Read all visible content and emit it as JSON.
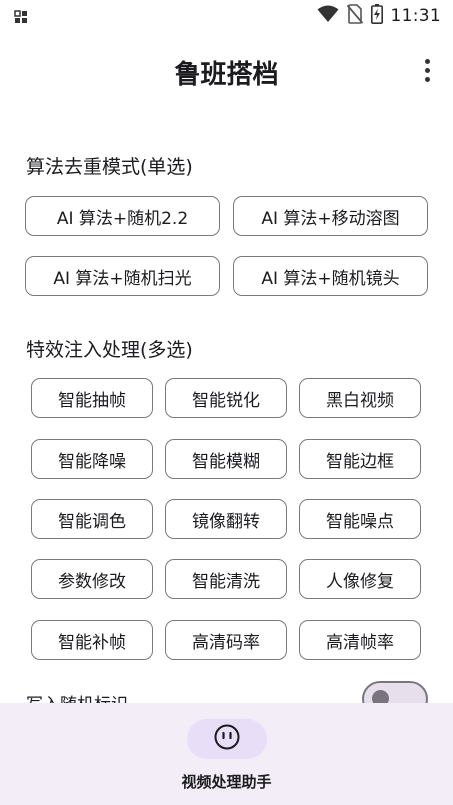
{
  "status_bar": {
    "time": "11:31",
    "icons": [
      "notification-grid-icon",
      "wifi-icon",
      "no-sim-icon",
      "battery-charging-icon"
    ]
  },
  "app_bar": {
    "title": "鲁班搭档",
    "menu_icon": "more-vert-icon"
  },
  "dedup_section": {
    "title": "算法去重模式(单选)",
    "options": [
      "AI 算法+随机2.2",
      "AI 算法+移动溶图",
      "AI 算法+随机扫光",
      "AI 算法+随机镜头"
    ]
  },
  "effects_section": {
    "title": "特效注入处理(多选)",
    "options": [
      "智能抽帧",
      "智能锐化",
      "黑白视频",
      "智能降噪",
      "智能模糊",
      "智能边框",
      "智能调色",
      "镜像翻转",
      "智能噪点",
      "参数修改",
      "智能清洗",
      "人像修复",
      "智能补帧",
      "高清码率",
      "高清帧率"
    ]
  },
  "random_mark": {
    "label": "写入随机标识",
    "enabled": false
  },
  "bottom_nav": {
    "icon": "smiley-face-icon",
    "label": "视频处理助手"
  },
  "colors": {
    "nav_background": "#f3edf7",
    "nav_indicator": "#e8def8",
    "chip_border": "#7a7a7a",
    "toggle_outline": "#79747e"
  }
}
